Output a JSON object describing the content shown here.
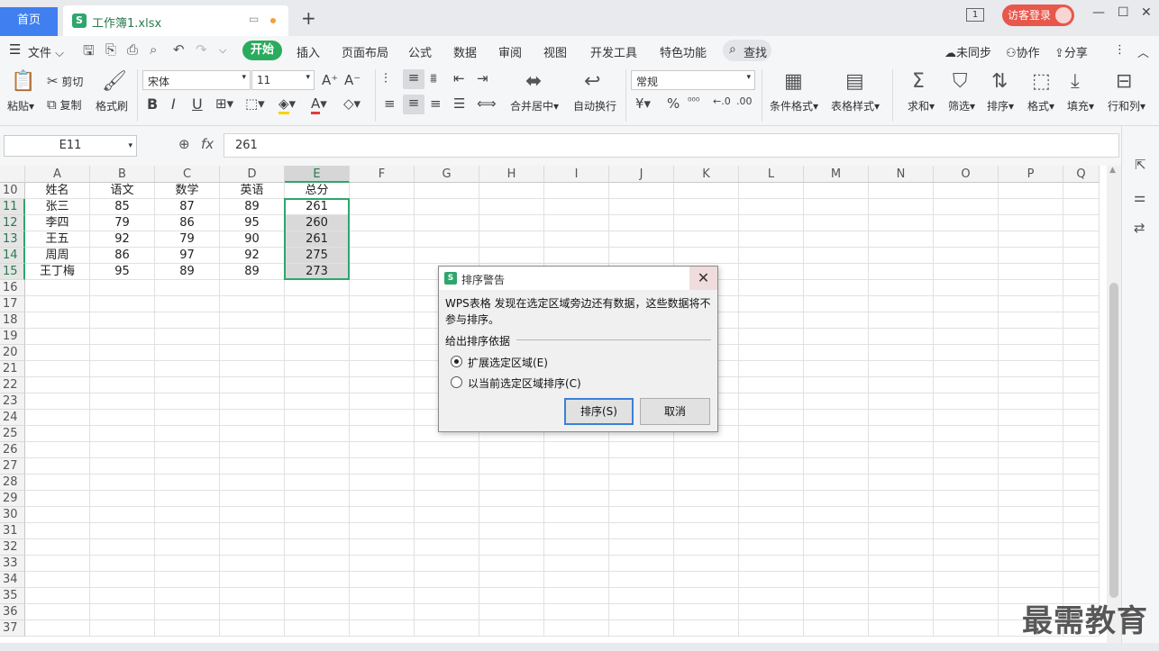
{
  "titlebar": {
    "home_tab": "首页",
    "file_tab": "工作簿1.xlsx",
    "file_icon": "S",
    "page_count": "1",
    "login": "访客登录"
  },
  "menu": {
    "file": "文件",
    "tabs": [
      "开始",
      "插入",
      "页面布局",
      "公式",
      "数据",
      "审阅",
      "视图",
      "开发工具",
      "特色功能"
    ],
    "search": "查找",
    "sync": "未同步",
    "collab": "协作",
    "share": "分享"
  },
  "ribbon": {
    "paste": "粘贴",
    "cut": "剪切",
    "copy": "复制",
    "format_painter": "格式刷",
    "font_name": "宋体",
    "font_size": "11",
    "merge_center": "合并居中",
    "wrap_text": "自动换行",
    "number_format": "常规",
    "cond_format": "条件格式",
    "table_style": "表格样式",
    "sum": "求和",
    "filter": "筛选",
    "sort": "排序",
    "format": "格式",
    "fill": "填充",
    "row_col": "行和列"
  },
  "formula_bar": {
    "name_box": "E11",
    "fx": "fx",
    "value": "261"
  },
  "sheet": {
    "columns": [
      "A",
      "B",
      "C",
      "D",
      "E",
      "F",
      "G",
      "H",
      "I",
      "J",
      "K",
      "L",
      "M",
      "N",
      "O",
      "P",
      "Q"
    ],
    "rows": [
      "10",
      "11",
      "12",
      "13",
      "14",
      "15",
      "16",
      "17",
      "18",
      "19",
      "20",
      "21",
      "22",
      "23",
      "24",
      "25",
      "26",
      "27",
      "28",
      "29",
      "30",
      "31",
      "32",
      "33",
      "34",
      "35",
      "36",
      "37"
    ],
    "data": [
      [
        "姓名",
        "语文",
        "数学",
        "英语",
        "总分"
      ],
      [
        "张三",
        "85",
        "87",
        "89",
        "261"
      ],
      [
        "李四",
        "79",
        "86",
        "95",
        "260"
      ],
      [
        "王五",
        "92",
        "79",
        "90",
        "261"
      ],
      [
        "周周",
        "86",
        "97",
        "92",
        "275"
      ],
      [
        "王丁梅",
        "95",
        "89",
        "89",
        "273"
      ]
    ]
  },
  "dialog": {
    "title": "排序警告",
    "message": "WPS表格 发现在选定区域旁边还有数据，这些数据将不参与排序。",
    "group_label": "给出排序依据",
    "option1": "扩展选定区域(E)",
    "option2": "以当前选定区域排序(C)",
    "sort_btn": "排序(S)",
    "cancel_btn": "取消"
  },
  "watermark": "最需教育"
}
